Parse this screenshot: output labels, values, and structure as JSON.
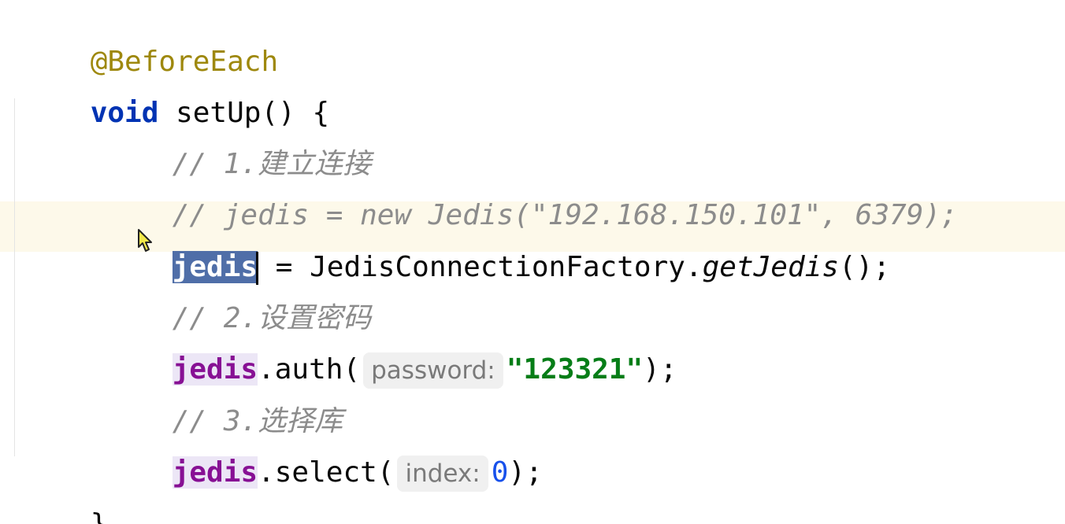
{
  "code": {
    "annotation": "@BeforeEach",
    "void_kw": "void",
    "method_sig": " setUp() {",
    "comment1": "// 1.建立连接",
    "comment2": "// jedis = new Jedis(\"192.168.150.101\", 6379);",
    "field_selected": "jedis",
    "assign_rest_a": " = JedisConnectionFactory.",
    "static_method": "getJedis",
    "assign_rest_b": "();",
    "comment3": "// 2.设置密码",
    "field_auth": "jedis",
    "auth_call": ".auth(",
    "auth_hint": "password:",
    "auth_value": "\"123321\"",
    "auth_end": ");",
    "comment4": "// 3.选择库",
    "field_select": "jedis",
    "select_call": ".select(",
    "select_hint": "index:",
    "select_value": "0",
    "select_end": ");",
    "close_brace": "}"
  },
  "colors": {
    "annotation": "#9e880d",
    "keyword": "#0033b3",
    "comment": "#8c8c8c",
    "field": "#871094",
    "string": "#067d17",
    "number": "#1750eb",
    "selection": "#4f6ea8",
    "current_line": "#fdf9ea"
  },
  "icons": {
    "mouse_cursor": "arrow-pointer-icon"
  }
}
